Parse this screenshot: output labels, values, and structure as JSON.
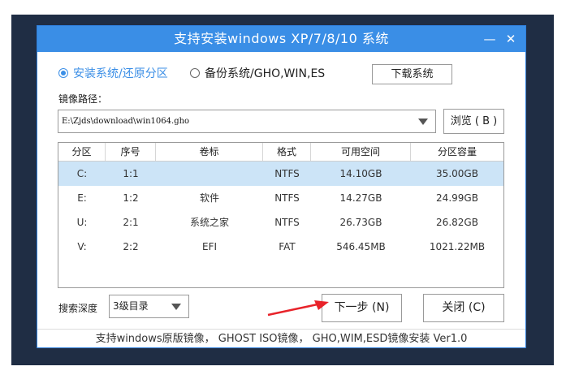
{
  "window": {
    "title": "支持安装windows XP/7/8/10 系统",
    "minimize_glyph": "—",
    "close_glyph": "✕"
  },
  "mode": {
    "install_label": "安装系统/还原分区",
    "backup_label": "备份系统/GHO,WIN,ES",
    "selected": "install"
  },
  "download_button": "下载系统",
  "image_path": {
    "label": "镜像路径：",
    "value": "E:\\Zjds\\download\\win1064.gho",
    "browse_button": "浏览 ( B )"
  },
  "partition_table": {
    "columns": [
      "分区",
      "序号",
      "卷标",
      "格式",
      "可用空间",
      "分区容量"
    ],
    "rows": [
      {
        "drive": "C:",
        "index": "1:1",
        "label": "",
        "format": "NTFS",
        "free": "14.10GB",
        "capacity": "35.00GB",
        "selected": true
      },
      {
        "drive": "E:",
        "index": "1:2",
        "label": "软件",
        "format": "NTFS",
        "free": "14.27GB",
        "capacity": "24.99GB",
        "selected": false
      },
      {
        "drive": "U:",
        "index": "2:1",
        "label": "系统之家",
        "format": "NTFS",
        "free": "26.73GB",
        "capacity": "26.82GB",
        "selected": false
      },
      {
        "drive": "V:",
        "index": "2:2",
        "label": "EFI",
        "format": "FAT",
        "free": "546.45MB",
        "capacity": "1021.22MB",
        "selected": false
      }
    ]
  },
  "search_depth": {
    "label": "搜索深度",
    "value": "3级目录"
  },
  "next_button": "下一步 (N)",
  "close_button": "关闭 (C)",
  "footer": "支持windows原版镜像，  GHOST ISO镜像，  GHO,WIM,ESD镜像安装 Ver1.0",
  "colors": {
    "accent": "#3a8ee6",
    "selected_row": "#cce4f7",
    "annotation_arrow": "#e8232a",
    "backdrop": "#1f2d44"
  }
}
